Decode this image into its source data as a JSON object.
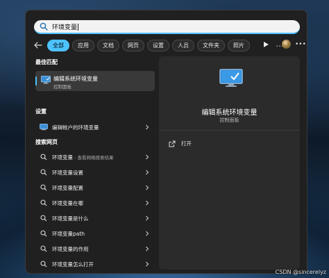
{
  "search": {
    "query": "环境变量"
  },
  "filters": {
    "tabs": [
      {
        "label": "全部",
        "active": true
      },
      {
        "label": "应用",
        "active": false
      },
      {
        "label": "文档",
        "active": false
      },
      {
        "label": "网页",
        "active": false
      },
      {
        "label": "设置",
        "active": false
      },
      {
        "label": "人员",
        "active": false
      },
      {
        "label": "文件夹",
        "active": false
      },
      {
        "label": "照片",
        "active": false
      }
    ],
    "more": "…"
  },
  "best_match": {
    "section": "最佳匹配",
    "title": "编辑系统环境变量",
    "subtitle": "控制面板"
  },
  "settings": {
    "section": "设置",
    "items": [
      {
        "label": "编辑帐户的环境变量"
      }
    ]
  },
  "web": {
    "section": "搜索网页",
    "items": [
      {
        "label": "环境变量",
        "hint": " - 查看网络搜索结果"
      },
      {
        "label": "环境变量设置",
        "hint": ""
      },
      {
        "label": "环境变量配置",
        "hint": ""
      },
      {
        "label": "环境变量在哪",
        "hint": ""
      },
      {
        "label": "环境变量是什么",
        "hint": ""
      },
      {
        "label": "环境变量path",
        "hint": ""
      },
      {
        "label": "环境变量的作用",
        "hint": ""
      },
      {
        "label": "环境变量怎么打开",
        "hint": ""
      }
    ]
  },
  "preview": {
    "title": "编辑系统环境变量",
    "subtitle": "控制面板",
    "actions": [
      {
        "label": "打开"
      }
    ]
  },
  "watermark": "CSDN @sincerelyz",
  "colors": {
    "accent": "#4cc2ff",
    "panel": "#202020",
    "preview": "#2b2b2b"
  }
}
